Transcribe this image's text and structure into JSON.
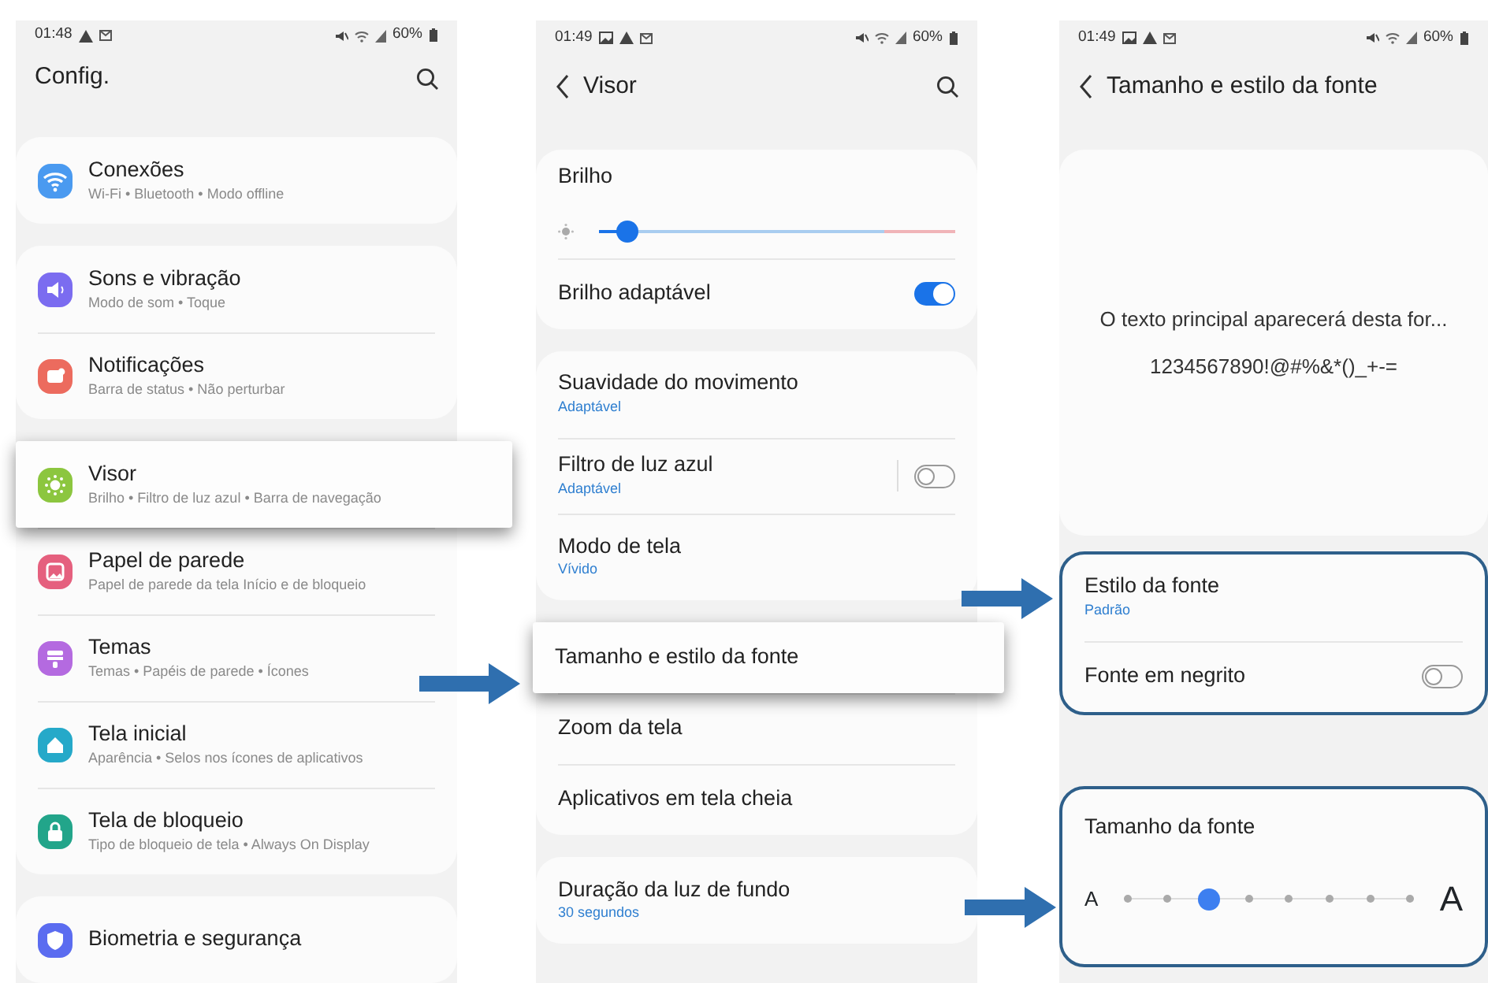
{
  "screens": [
    {
      "status_bar": {
        "time": "01:48",
        "battery": "60%",
        "image_notification": false
      },
      "header": {
        "title": "Config.",
        "back": false,
        "search": true
      },
      "groups": [
        {
          "outlined": false,
          "items": [
            {
              "kind": "nav",
              "title": "Conexões",
              "subtitle": "Wi-Fi  •  Bluetooth  •  Modo offline",
              "color": "#4a9af0",
              "highlighted": false
            }
          ]
        },
        {
          "outlined": false,
          "items": [
            {
              "kind": "nav",
              "title": "Sons e vibração",
              "subtitle": "Modo de som  •  Toque",
              "color": "#7b6cf0",
              "highlighted": false
            },
            {
              "kind": "nav",
              "title": "Notificações",
              "subtitle": "Barra de status  •  Não perturbar",
              "color": "#ec6b5e",
              "highlighted": false
            }
          ]
        },
        {
          "outlined": false,
          "items": [
            {
              "kind": "nav",
              "title": "Visor",
              "subtitle": "Brilho  •  Filtro de luz azul  •  Barra de navegação",
              "color": "#8cc63f",
              "highlighted": true
            },
            {
              "kind": "nav",
              "title": "Papel de parede",
              "subtitle": "Papel de parede da tela Início e de bloqueio",
              "color": "#e5607e",
              "highlighted": false
            },
            {
              "kind": "nav",
              "title": "Temas",
              "subtitle": "Temas  •  Papéis de parede  •  Ícones",
              "color": "#b46ae0",
              "highlighted": false
            },
            {
              "kind": "nav",
              "title": "Tela inicial",
              "subtitle": "Aparência  •  Selos nos ícones de aplicativos",
              "color": "#25a9c9",
              "highlighted": false
            },
            {
              "kind": "nav",
              "title": "Tela de bloqueio",
              "subtitle": "Tipo de bloqueio de tela  •  Always On Display",
              "color": "#22a58a",
              "highlighted": false
            }
          ]
        },
        {
          "outlined": false,
          "items": [
            {
              "kind": "nav",
              "title": "Biometria e segurança",
              "color": "#5b6cf0",
              "highlighted": false
            }
          ]
        }
      ]
    },
    {
      "status_bar": {
        "time": "01:49",
        "battery": "60%",
        "image_notification": true
      },
      "header": {
        "title": "Visor",
        "back": true,
        "search": true
      },
      "groups": [
        {
          "outlined": false,
          "items": [
            {
              "kind": "slider",
              "title": "Brilho",
              "level": 0.08,
              "highlighted": false
            },
            {
              "kind": "toggle",
              "title": "Brilho adaptável",
              "on": true,
              "highlighted": false
            }
          ]
        },
        {
          "outlined": false,
          "items": [
            {
              "kind": "option",
              "title": "Suavidade do movimento",
              "value": "Adaptável",
              "highlighted": false
            },
            {
              "kind": "toggle",
              "title": "Filtro de luz azul",
              "value": "Adaptável",
              "on": false,
              "highlighted": false
            },
            {
              "kind": "option",
              "title": "Modo de tela",
              "value": "Vívido",
              "highlighted": false
            }
          ]
        },
        {
          "outlined": false,
          "items": [
            {
              "kind": "option",
              "title": "Tamanho e estilo da fonte",
              "highlighted": true
            },
            {
              "kind": "option",
              "title": "Zoom da tela",
              "highlighted": false
            },
            {
              "kind": "option",
              "title": "Aplicativos em tela cheia",
              "highlighted": false
            }
          ]
        },
        {
          "outlined": false,
          "items": [
            {
              "kind": "option",
              "title": "Duração da luz de fundo",
              "value": "30 segundos",
              "highlighted": false
            }
          ]
        }
      ]
    },
    {
      "status_bar": {
        "time": "01:49",
        "battery": "60%",
        "image_notification": true
      },
      "header": {
        "title": "Tamanho e estilo da fonte",
        "back": true,
        "search": false
      },
      "groups": [
        {
          "outlined": false,
          "items": [
            {
              "kind": "preview",
              "lines": [
                "O texto principal aparecerá desta for...",
                "1234567890!@#%&*()_+-="
              ],
              "highlighted": false
            }
          ]
        },
        {
          "outlined": true,
          "items": [
            {
              "kind": "option",
              "title": "Estilo da fonte",
              "value": "Padrão",
              "highlighted": false
            },
            {
              "kind": "toggle",
              "title": "Fonte em negrito",
              "on": false,
              "highlighted": false
            }
          ]
        },
        {
          "outlined": true,
          "items": [
            {
              "kind": "steps",
              "title": "Tamanho da fonte",
              "min_label": "A",
              "max_label": "A",
              "level": 0.286,
              "highlighted": false
            }
          ]
        }
      ]
    }
  ]
}
